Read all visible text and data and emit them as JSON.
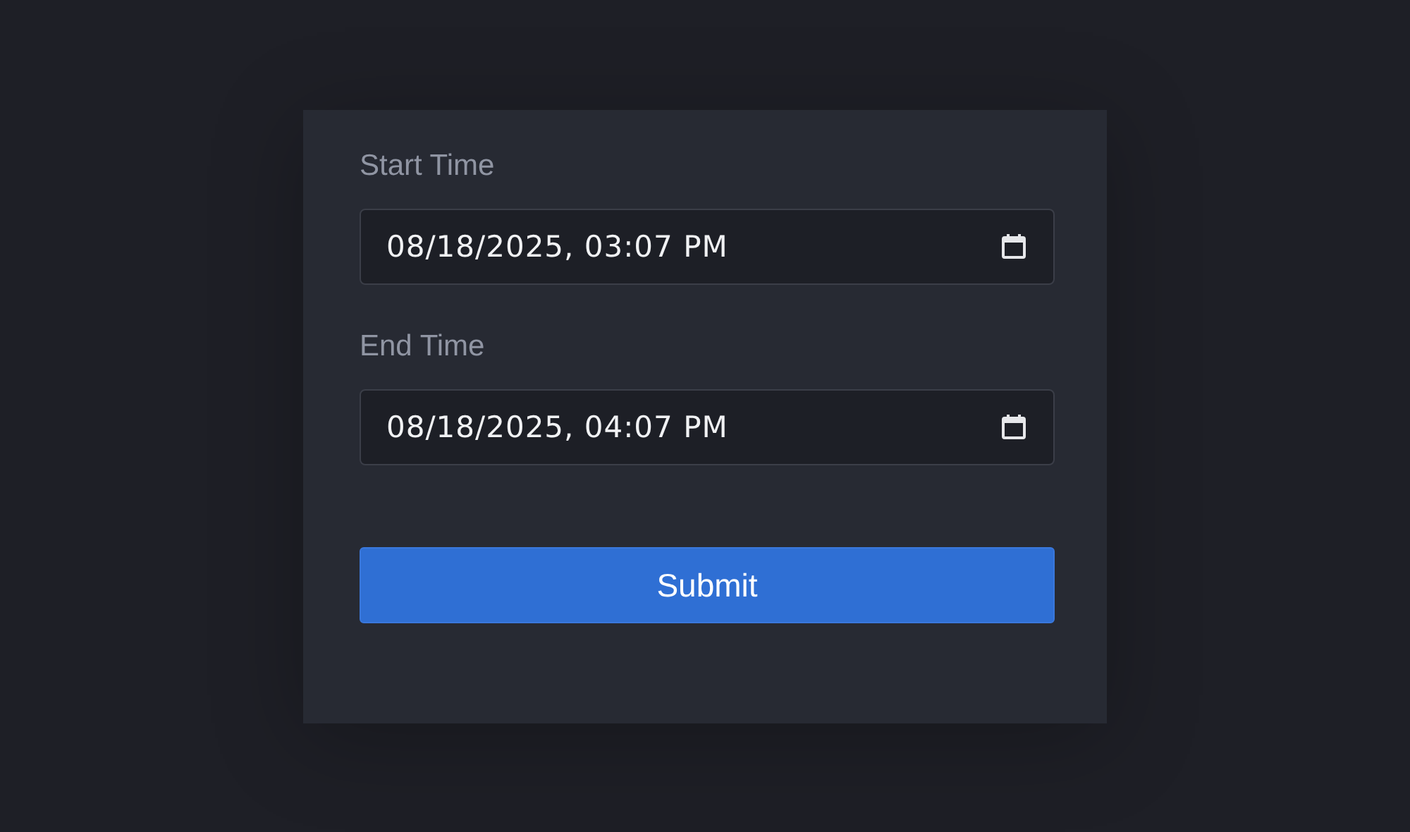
{
  "form": {
    "fields": [
      {
        "label": "Start Time",
        "value": "08/18/2025, 03:07 PM"
      },
      {
        "label": "End Time",
        "value": "08/18/2025, 04:07 PM"
      }
    ],
    "submit": "Submit"
  }
}
